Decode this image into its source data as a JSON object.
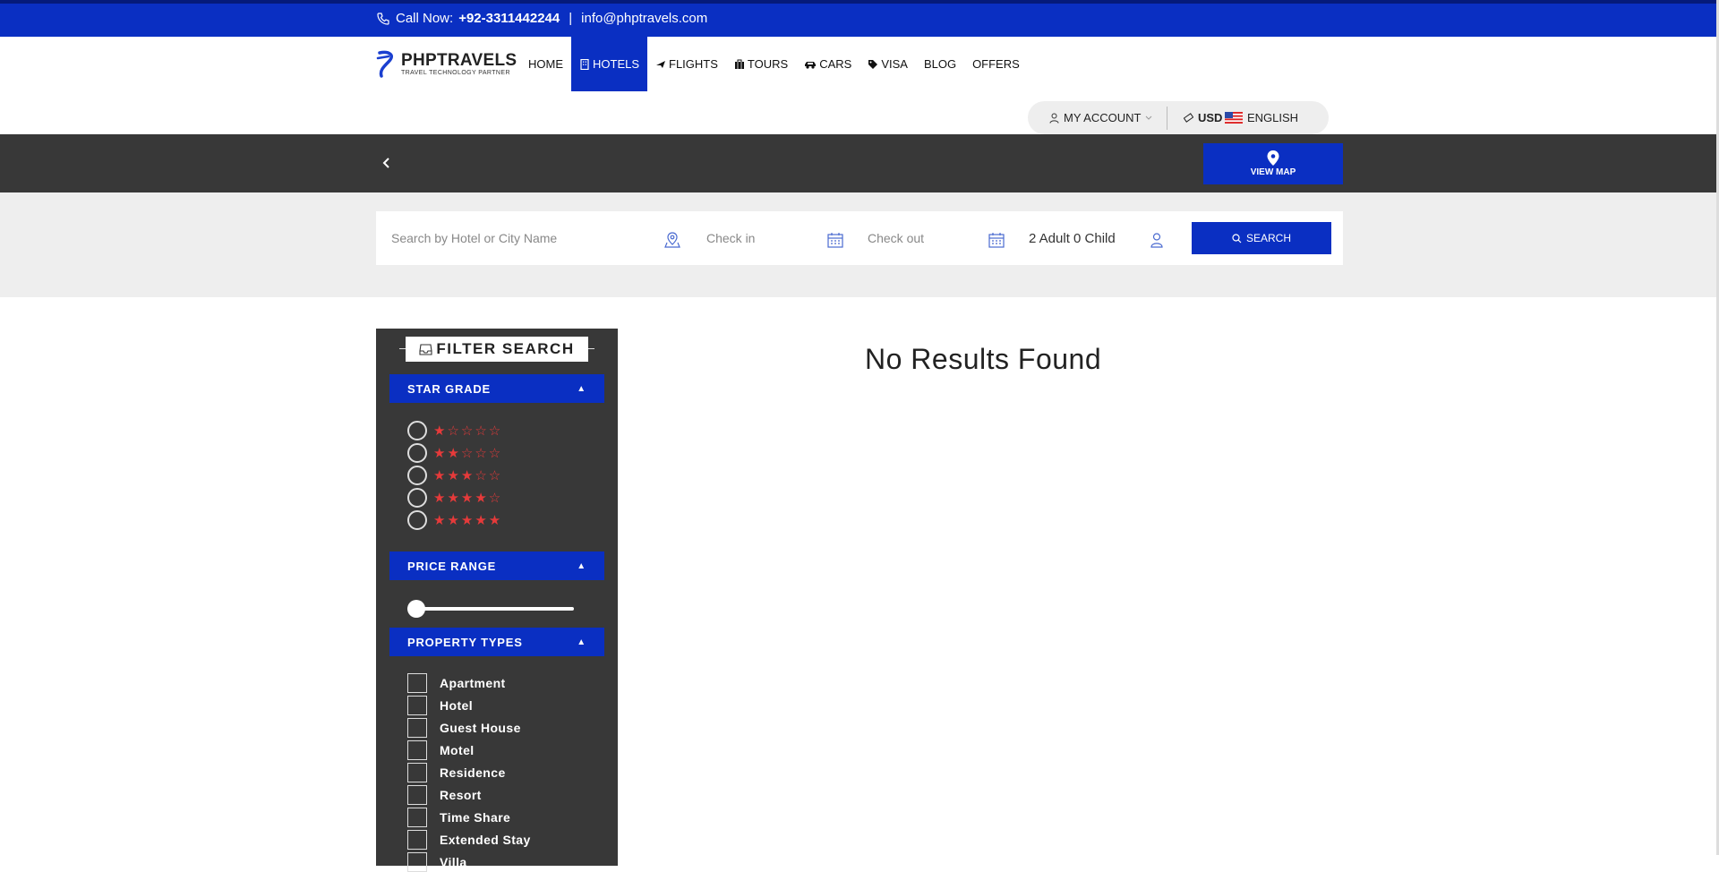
{
  "topbar": {
    "call_label": "Call Now:",
    "phone": "+92-3311442244",
    "separator": "|",
    "email": "info@phptravels.com"
  },
  "logo": {
    "name": "PHPTRAVELS",
    "tagline": "TRAVEL TECHNOLOGY PARTNER"
  },
  "nav": {
    "items": [
      {
        "label": "HOME",
        "icon": ""
      },
      {
        "label": "HOTELS",
        "icon": "building-icon"
      },
      {
        "label": "FLIGHTS",
        "icon": "plane-icon"
      },
      {
        "label": "TOURS",
        "icon": "suitcase-icon"
      },
      {
        "label": "CARS",
        "icon": "car-icon"
      },
      {
        "label": "VISA",
        "icon": "tag-icon"
      },
      {
        "label": "BLOG",
        "icon": ""
      },
      {
        "label": "OFFERS",
        "icon": ""
      }
    ],
    "active": "HOTELS"
  },
  "account": {
    "my_account": "MY ACCOUNT",
    "currency": "USD",
    "language": "ENGLISH"
  },
  "darkbar": {
    "view_map": "VIEW MAP"
  },
  "search": {
    "destination_placeholder": "Search by Hotel or City Name",
    "checkin_placeholder": "Check in",
    "checkout_placeholder": "Check out",
    "guests": "2 Adult 0 Child",
    "button": "SEARCH"
  },
  "filter": {
    "title": "FILTER SEARCH",
    "star_grade": {
      "heading": "STAR GRADE",
      "options": [
        1,
        2,
        3,
        4,
        5
      ]
    },
    "price_range": {
      "heading": "PRICE RANGE",
      "value_fraction": 0
    },
    "property_types": {
      "heading": "PROPERTY TYPES",
      "items": [
        "Apartment",
        "Hotel",
        "Guest House",
        "Motel",
        "Residence",
        "Resort",
        "Time Share",
        "Extended Stay",
        "Villa"
      ]
    }
  },
  "results": {
    "message": "No Results Found"
  },
  "colors": {
    "brand_blue": "#0a2fc2",
    "dark_bar": "#383838",
    "star_red": "#e63a3a"
  }
}
